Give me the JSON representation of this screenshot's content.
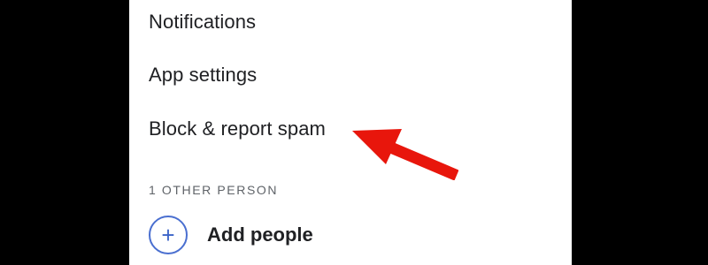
{
  "menu": {
    "notifications_label": "Notifications",
    "app_settings_label": "App settings",
    "block_report_label": "Block & report spam"
  },
  "people_section": {
    "header": "1 OTHER PERSON",
    "add_people_label": "Add people",
    "add_icon_glyph": "+"
  },
  "colors": {
    "accent": "#4a6fd0",
    "annotation_arrow": "#e8160c",
    "text_primary": "#202124",
    "text_secondary": "#5f6368"
  },
  "icons": {
    "add": "plus-circle-icon",
    "annotation": "red-arrow-icon"
  }
}
